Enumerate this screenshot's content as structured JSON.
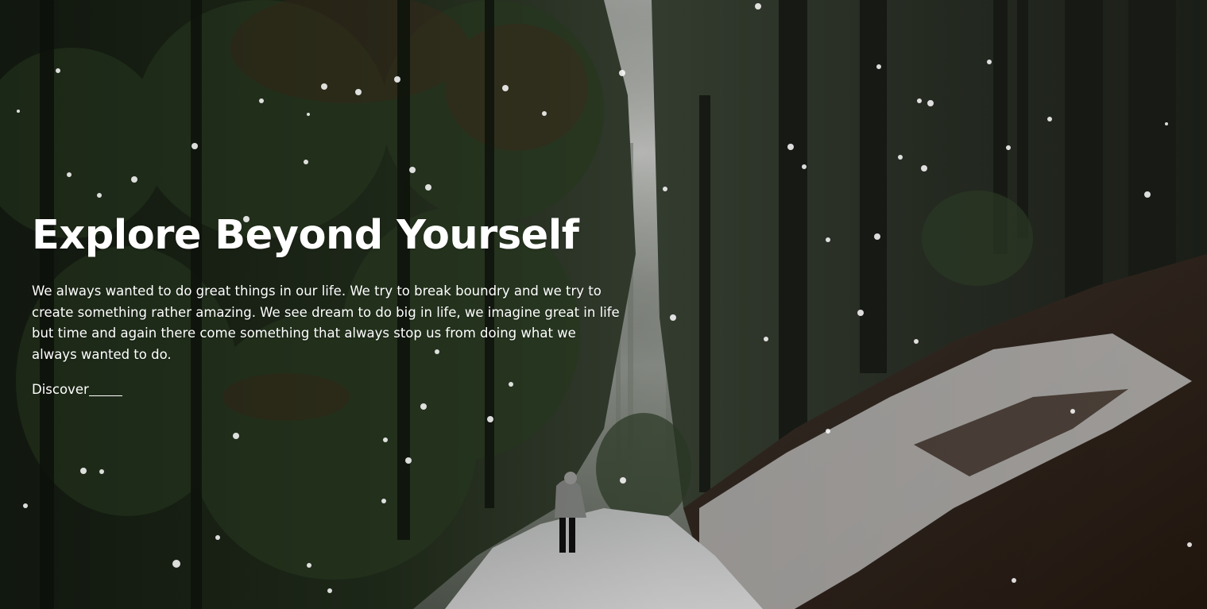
{
  "hero": {
    "title": "Explore Beyond Yourself",
    "description": "We always wanted to do great things in our life. We try to break boundry and we try to create something rather amazing. We see dream to do big in life, we imagine great in life but time and again there come something that always stop us from doing what we always wanted to do.",
    "cta_label": "Discover"
  },
  "background": {
    "scene": "snowy forest path with hiker",
    "colors": {
      "forest_dark": "#1c2219",
      "snow": "#dcdcdc",
      "fog": "#c4c6c3",
      "text": "#ffffff"
    }
  }
}
